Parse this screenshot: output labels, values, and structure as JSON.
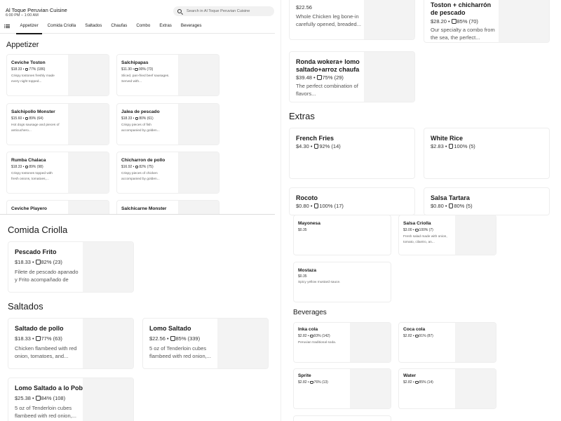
{
  "store": {
    "title": "Al Toque Peruvian Cuisine",
    "hours": "6:00 PM – 1:00 AM"
  },
  "search": {
    "placeholder": "Search in Al Toque Peruvian Cuisine"
  },
  "tabs": [
    "Appetizer",
    "Comida Criolla",
    "Saltados",
    "Chaufas",
    "Combo",
    "Extras",
    "Beverages"
  ],
  "sections": {
    "appetizer": "Appetizer",
    "comida_criolla": "Comida Criolla",
    "saltados": "Saltados",
    "extras": "Extras",
    "beverages": "Beverages"
  },
  "appetizer": [
    {
      "name": "Ceviche Toston",
      "price": "$18.33",
      "rating": "77% (186)",
      "desc": "Crispy tostones freshly made every night topped..."
    },
    {
      "name": "Salchipapas",
      "price": "$11.30",
      "rating": "90% (73)",
      "desc": "Sliced, pan-fried beef sausages. Served with..."
    },
    {
      "name": "Salchipollo Monster",
      "price": "$15.60",
      "rating": "89% (64)",
      "desc": "Hot dogs sausage and pieces of anticuchero..."
    },
    {
      "name": "Jalea de pescado",
      "price": "$18.33",
      "rating": "80% (61)",
      "desc": "Crispy pieces of fish accompanied by golden..."
    },
    {
      "name": "Rumba Chalaca",
      "price": "$18.33",
      "rating": "89% (98)",
      "desc": "Crispy tostones topped with fresh onions, tomatoes,..."
    },
    {
      "name": "Chicharron de pollo",
      "price": "$16.92",
      "rating": "82% (75)",
      "desc": "Crispy pieces of chicken accompanied by golden..."
    },
    {
      "name": "Ceviche Playero"
    },
    {
      "name": "Salchicarne Monster"
    }
  ],
  "comida_criolla": [
    {
      "name": "Pescado Frito",
      "price": "$18.33",
      "rating": "82% (23)",
      "desc": "Filete de pescado apanado y Frito acompañado de papa..."
    }
  ],
  "saltados": [
    {
      "name": "Saltado de pollo",
      "price": "$18.33",
      "rating": "77% (63)",
      "desc": "Chicken flambeed with red onion, tomatoes, and..."
    },
    {
      "name": "Lomo Saltado",
      "price": "$22.56",
      "rating": "85% (339)",
      "desc": "5 oz of Tenderloin cubes flambeed with red onion,..."
    },
    {
      "name": "Lomo Saltado a lo Pobre",
      "price": "$25.38",
      "rating": "84% (108)",
      "desc": "5 oz of Tenderloin cubes flambeed with red onion,..."
    }
  ],
  "combo": [
    {
      "price": "$22.56",
      "desc": "Whole Chicken leg bone-in carefully opened, breaded..."
    },
    {
      "name": "Toston + chicharrón de pescado",
      "price": "$28.20",
      "rating": "85% (70)",
      "desc": "Our specialty a combo from the sea, the perfect..."
    },
    {
      "name": "Ronda wokera+ lomo saltado+arroz chaufa",
      "price": "$39.48",
      "rating": "75% (29)",
      "desc": "The perfect combination of flavors..."
    }
  ],
  "extras": [
    {
      "name": "French Fries",
      "price": "$4.30",
      "rating": "92% (14)"
    },
    {
      "name": "White Rice",
      "price": "$2.83",
      "rating": "100% (5)"
    },
    {
      "name": "Rocoto",
      "price": "$0.80",
      "rating": "100% (17)"
    },
    {
      "name": "Salsa Tartara",
      "price": "$0.80",
      "rating": "80% (5)"
    },
    {
      "name": "Mayonesa",
      "price": "$0.35"
    },
    {
      "name": "Salsa Criolla",
      "price": "$3.00",
      "rating": "100% (7)",
      "desc": "Fresh salad made with onion, tomato, cilantro, an..."
    },
    {
      "name": "Mostaza",
      "price": "$0.35",
      "desc": "Spicy yellow mustard sauce."
    }
  ],
  "beverages": [
    {
      "name": "Inka cola",
      "price": "$2.82",
      "rating": "93% (142)",
      "desc": "Peruvian traditional soda."
    },
    {
      "name": "Coca cola",
      "price": "$2.82",
      "rating": "91% (87)"
    },
    {
      "name": "Sprite",
      "price": "$2.82",
      "rating": "76% (13)"
    },
    {
      "name": "Water",
      "price": "$2.82",
      "rating": "85% (14)"
    }
  ]
}
